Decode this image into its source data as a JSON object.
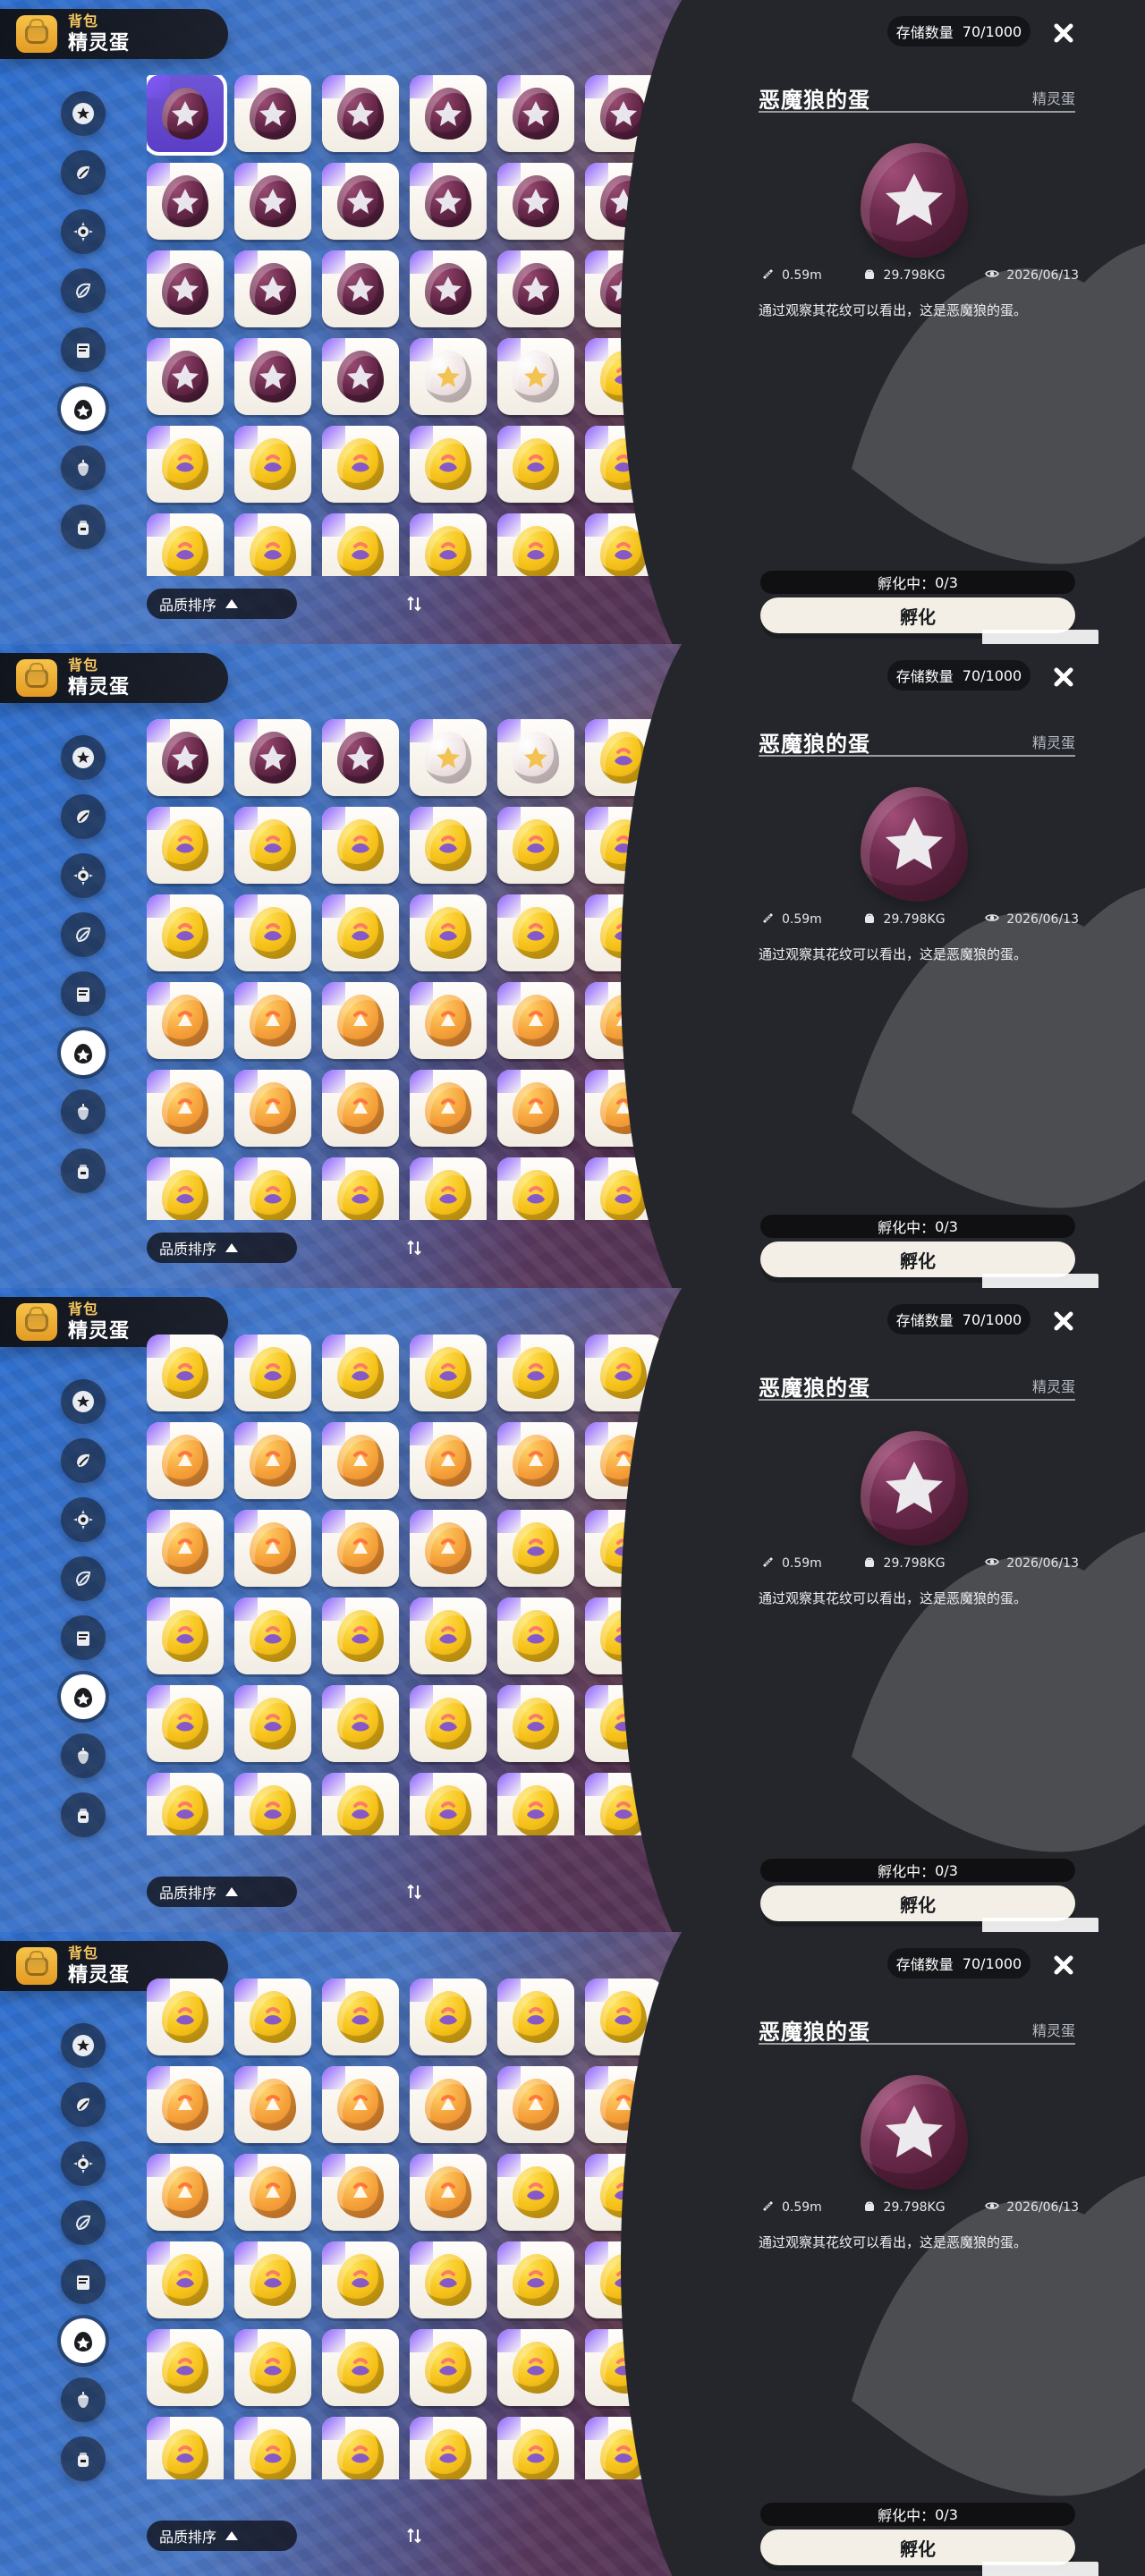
{
  "header": {
    "tag_small": "背包",
    "tag_main": "精灵蛋"
  },
  "top_right": {
    "storage_label": "存储数量",
    "storage_value": "70/1000",
    "close_label": "✕"
  },
  "sidebar": {
    "items": [
      {
        "icon": "star-badge"
      },
      {
        "icon": "leaf"
      },
      {
        "icon": "gear"
      },
      {
        "icon": "leaf-outline"
      },
      {
        "icon": "book"
      },
      {
        "icon": "egg",
        "active": true
      },
      {
        "icon": "acorn"
      },
      {
        "icon": "backpack"
      }
    ]
  },
  "sort": {
    "label": "品质排序",
    "toggle_glyph": "⇅"
  },
  "detail": {
    "title": "恶魔狼的蛋",
    "type": "精灵蛋",
    "height": "0.59m",
    "weight": "29.798KG",
    "date": "2026/06/13",
    "description": "通过观察其花纹可以看出，这是恶魔狼的蛋。",
    "hatch_status_label": "孵化中：",
    "hatch_status_value": "0/3",
    "hatch_button": "孵化"
  },
  "grids": [
    {
      "scrolled": false,
      "selected_index": 0,
      "eggs": [
        "purple",
        "purple",
        "purple",
        "purple",
        "purple",
        "purple",
        "purple",
        "purple",
        "purple",
        "purple",
        "purple",
        "purple",
        "purple",
        "purple",
        "purple",
        "purple",
        "purple",
        "purple",
        "purple",
        "purple",
        "purple",
        "white",
        "white",
        "yellow",
        "yellow",
        "yellow",
        "yellow",
        "yellow",
        "yellow",
        "yellow",
        "yellow",
        "yellow",
        "yellow",
        "yellow",
        "yellow",
        "yellow"
      ]
    },
    {
      "scrolled": false,
      "selected_index": -1,
      "eggs": [
        "purple",
        "purple",
        "purple",
        "white",
        "white",
        "yellow",
        "yellow",
        "yellow",
        "yellow",
        "yellow",
        "yellow",
        "yellow",
        "yellow",
        "yellow",
        "yellow",
        "yellow",
        "yellow",
        "yellow",
        "orange",
        "orange",
        "orange",
        "orange",
        "orange",
        "orange",
        "orange",
        "orange",
        "orange",
        "orange",
        "orange",
        "orange",
        "yellow",
        "yellow",
        "yellow",
        "yellow",
        "yellow",
        "yellow"
      ]
    },
    {
      "scrolled": true,
      "selected_index": -1,
      "eggs": [
        "yellow",
        "yellow",
        "yellow",
        "yellow",
        "yellow",
        "yellow",
        "orange",
        "orange",
        "orange",
        "orange",
        "orange",
        "orange",
        "orange",
        "orange",
        "orange",
        "orange",
        "yellow",
        "yellow",
        "yellow",
        "yellow",
        "yellow",
        "yellow",
        "yellow",
        "yellow",
        "yellow",
        "yellow",
        "yellow",
        "yellow",
        "yellow",
        "yellow",
        "yellow",
        "yellow",
        "yellow",
        "yellow",
        "yellow",
        "yellow",
        "yellow",
        "yellow",
        "yellow",
        "yellow"
      ]
    },
    {
      "scrolled": true,
      "selected_index": -1,
      "eggs": [
        "yellow",
        "yellow",
        "yellow",
        "yellow",
        "yellow",
        "yellow",
        "orange",
        "orange",
        "orange",
        "orange",
        "orange",
        "orange",
        "orange",
        "orange",
        "orange",
        "orange",
        "yellow",
        "yellow",
        "yellow",
        "yellow",
        "yellow",
        "yellow",
        "yellow",
        "yellow",
        "yellow",
        "yellow",
        "yellow",
        "yellow",
        "yellow",
        "yellow",
        "yellow",
        "yellow",
        "yellow",
        "yellow",
        "yellow",
        "yellow",
        "yellow",
        "yellow",
        "yellow",
        "yellow"
      ]
    }
  ],
  "colors": {
    "accent_purple": "#8657ff",
    "panel_dark": "#24262b",
    "button_light": "#f3efe6"
  }
}
